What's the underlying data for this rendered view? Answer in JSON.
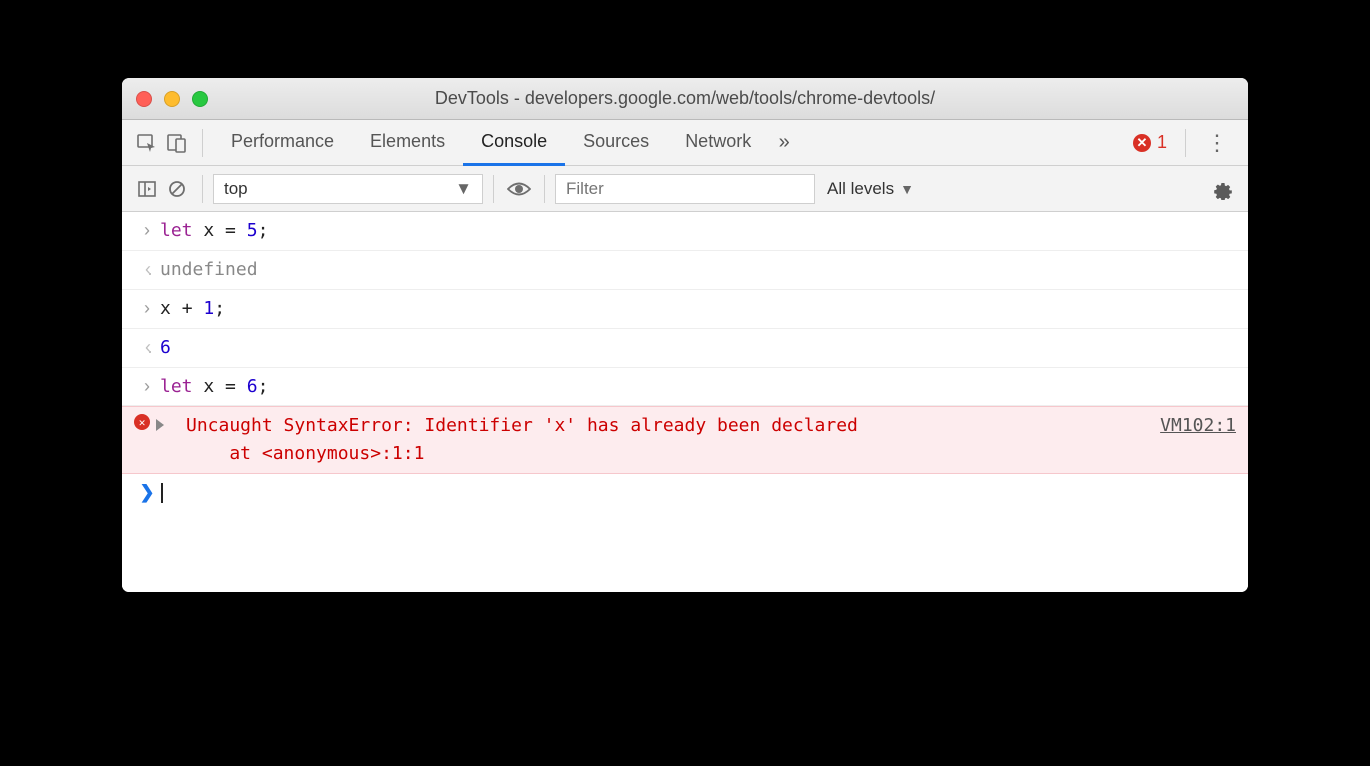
{
  "titlebar": {
    "title": "DevTools - developers.google.com/web/tools/chrome-devtools/"
  },
  "tabs": {
    "items": [
      "Performance",
      "Elements",
      "Console",
      "Sources",
      "Network"
    ],
    "active": "Console",
    "overflow": "»",
    "error_count": "1"
  },
  "toolbar": {
    "context": "top",
    "filter_placeholder": "Filter",
    "levels": "All levels"
  },
  "console": {
    "rows": [
      {
        "kind": "input",
        "tokens": [
          [
            "kw",
            "let"
          ],
          [
            "plain",
            " x "
          ],
          [
            "plain",
            "= "
          ],
          [
            "num",
            "5"
          ],
          [
            "plain",
            ";"
          ]
        ]
      },
      {
        "kind": "output",
        "tokens": [
          [
            "undef",
            "undefined"
          ]
        ]
      },
      {
        "kind": "input",
        "tokens": [
          [
            "plain",
            "x "
          ],
          [
            "plain",
            "+ "
          ],
          [
            "num",
            "1"
          ],
          [
            "plain",
            ";"
          ]
        ]
      },
      {
        "kind": "output",
        "tokens": [
          [
            "num",
            "6"
          ]
        ]
      },
      {
        "kind": "input",
        "tokens": [
          [
            "kw",
            "let"
          ],
          [
            "plain",
            " x "
          ],
          [
            "plain",
            "= "
          ],
          [
            "num",
            "6"
          ],
          [
            "plain",
            ";"
          ]
        ]
      }
    ],
    "error": {
      "line1": "Uncaught SyntaxError: Identifier 'x' has already been declared",
      "line2": "    at <anonymous>:1:1",
      "source": "VM102:1"
    }
  }
}
